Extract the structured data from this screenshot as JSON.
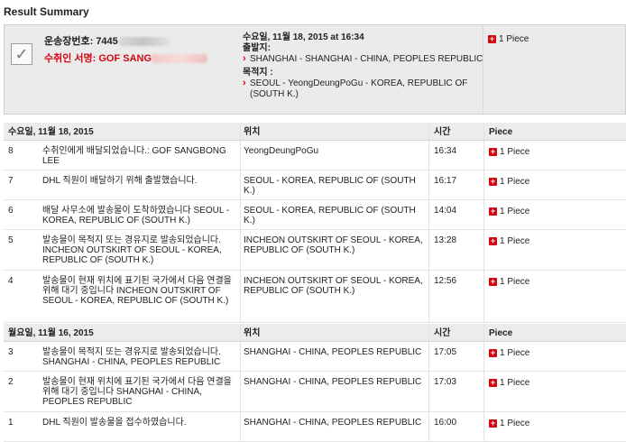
{
  "title": "Result Summary",
  "summary": {
    "waybill_label": "운송장번호: 7445",
    "signer_label": "수취인 서명: GOF SANG",
    "date_line": "수요일, 11월 18, 2015 at 16:34",
    "origin_label": "출발지:",
    "origin_value": "SHANGHAI - SHANGHAI - CHINA, PEOPLES REPUBLIC",
    "dest_label": "목적지 :",
    "dest_value": "SEOUL - YeongDeungPoGu - KOREA, REPUBLIC OF (SOUTH K.)",
    "piece": "1 Piece"
  },
  "groups": [
    {
      "header": {
        "date": "수요일, 11월 18, 2015",
        "location": "위치",
        "time": "시간",
        "piece": "Piece"
      },
      "rows": [
        {
          "num": "8",
          "desc": "수취인에게 배달되었습니다.: GOF SANGBONG LEE",
          "location": "YeongDeungPoGu",
          "time": "16:34",
          "piece": "1 Piece"
        },
        {
          "num": "7",
          "desc": "DHL 직원이 배달하기 위해 출발했습니다.",
          "location": "SEOUL - KOREA, REPUBLIC OF (SOUTH K.)",
          "time": "16:17",
          "piece": "1 Piece"
        },
        {
          "num": "6",
          "desc": "배달 사무소에 발송물이 도착하였습니다 SEOUL - KOREA, REPUBLIC OF (SOUTH K.)",
          "location": "SEOUL - KOREA, REPUBLIC OF (SOUTH K.)",
          "time": "14:04",
          "piece": "1 Piece"
        },
        {
          "num": "5",
          "desc": "발송물이 목적지 또는 경유지로 발송되었습니다. INCHEON OUTSKIRT OF SEOUL - KOREA, REPUBLIC OF (SOUTH K.)",
          "location": "INCHEON OUTSKIRT OF SEOUL - KOREA, REPUBLIC OF (SOUTH K.)",
          "time": "13:28",
          "piece": "1 Piece"
        },
        {
          "num": "4",
          "desc": "발송물이 현재 위치에 표기된 국가에서 다음 연결을 위해 대기 중입니다 INCHEON OUTSKIRT OF SEOUL - KOREA, REPUBLIC OF (SOUTH K.)",
          "location": "INCHEON OUTSKIRT OF SEOUL - KOREA, REPUBLIC OF (SOUTH K.)",
          "time": "12:56",
          "piece": "1 Piece"
        }
      ]
    },
    {
      "header": {
        "date": "월요일, 11월 16, 2015",
        "location": "위치",
        "time": "시간",
        "piece": "Piece"
      },
      "rows": [
        {
          "num": "3",
          "desc": "발송물이 목적지 또는 경유지로 발송되었습니다. SHANGHAI - CHINA, PEOPLES REPUBLIC",
          "location": "SHANGHAI - CHINA, PEOPLES REPUBLIC",
          "time": "17:05",
          "piece": "1 Piece"
        },
        {
          "num": "2",
          "desc": "발송물이 현재 위치에 표기된 국가에서 다음 연결을 위해 대기 중입니다 SHANGHAI - CHINA, PEOPLES REPUBLIC",
          "location": "SHANGHAI - CHINA, PEOPLES REPUBLIC",
          "time": "17:03",
          "piece": "1 Piece"
        },
        {
          "num": "1",
          "desc": "DHL 직원이 발송물을 접수하였습니다.",
          "location": "SHANGHAI - CHINA, PEOPLES REPUBLIC",
          "time": "16:00",
          "piece": "1 Piece"
        }
      ]
    }
  ],
  "colors": {
    "accent": "#d40511",
    "header_bg": "#ececec",
    "summary_bg": "#ebebeb"
  },
  "icons": {
    "status": "checkmark-icon",
    "expand": "plus-icon"
  }
}
